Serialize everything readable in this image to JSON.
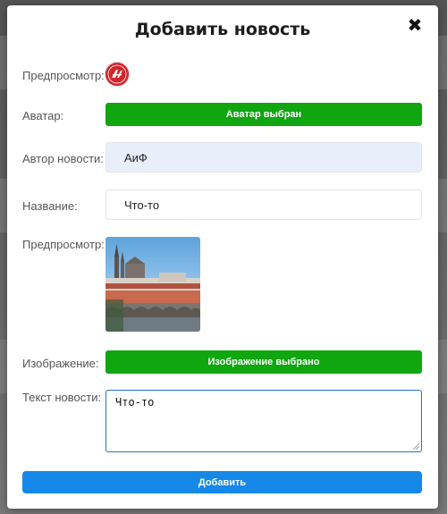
{
  "modal": {
    "title": "Добавить новость",
    "close_symbol": "✖"
  },
  "form": {
    "avatar_preview_label": "Предпросмотр:",
    "avatar_label": "Аватар:",
    "avatar_button": "Аватар выбран",
    "author_label": "Автор новости:",
    "author_value": "АиФ",
    "title_label": "Название:",
    "title_value": "Что-то",
    "image_preview_label": "Предпросмотр:",
    "image_label": "Изображение:",
    "image_button": "Изображение выбрано",
    "text_label": "Текст новости:",
    "text_value": "Что-то",
    "submit_button": "Добавить"
  },
  "icons": {
    "close": "close-icon",
    "avatar": "aif-logo-avatar",
    "image": "prague-castle-photo"
  },
  "colors": {
    "green_button": "#0fa60f",
    "blue_button": "#1588e8",
    "avatar_red": "#d7242b",
    "input_filled": "#e9effa"
  }
}
